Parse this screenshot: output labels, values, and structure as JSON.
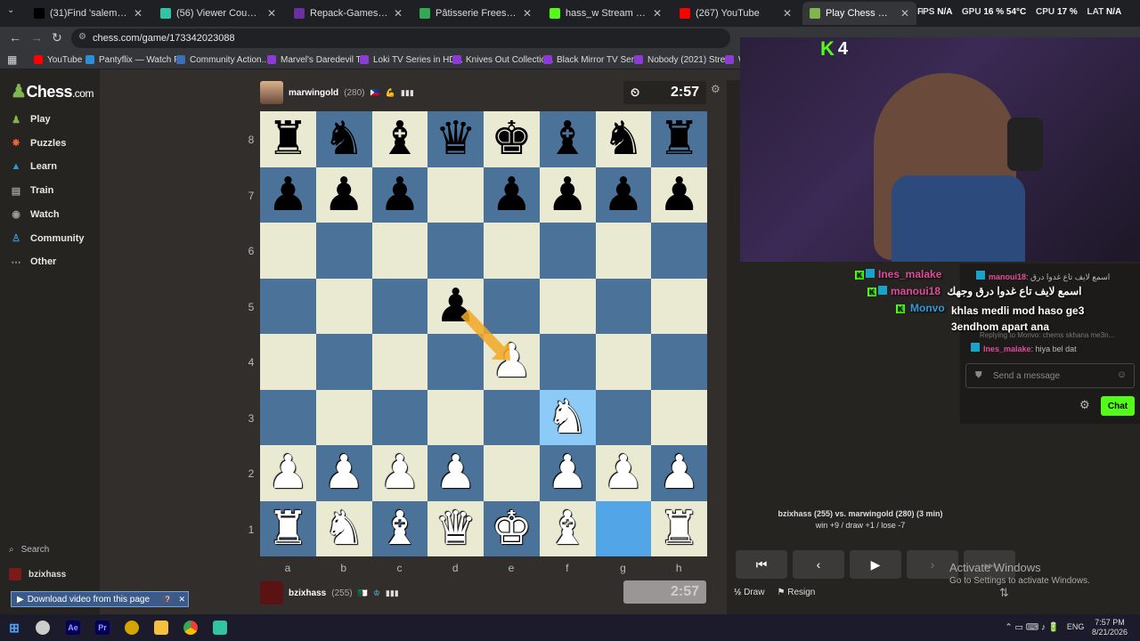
{
  "browser": {
    "tabs": [
      {
        "title": "(31)Find 'salember' on TikTok",
        "color": "#000000"
      },
      {
        "title": "(56) Viewer Count / Streamlabs",
        "color": "#31c3a2"
      },
      {
        "title": "Repack-Games - Free Download",
        "color": "#6b2fa0"
      },
      {
        "title": "Pâtisserie Freesia - Google Maps",
        "color": "#34a853"
      },
      {
        "title": "hass_w Stream - Watch Live",
        "color": "#53fc18"
      },
      {
        "title": "(267) YouTube",
        "color": "#ff0000"
      },
      {
        "title": "Play Chess Online for Free",
        "color": "#81b64c"
      }
    ],
    "url": "chess.com/game/173342023088",
    "bookmarks": [
      {
        "label": "YouTube",
        "color": "#ff0000"
      },
      {
        "label": "Pantyflix — Watch F...",
        "color": "#2d8fd8"
      },
      {
        "label": "Community Action...",
        "color": "#3b6fb6"
      },
      {
        "label": "Marvel's Daredevil T...",
        "color": "#8e3bd6"
      },
      {
        "label": "Loki TV Series in HD...",
        "color": "#8e3bd6"
      },
      {
        "label": "Knives Out Collectio...",
        "color": "#8e3bd6"
      },
      {
        "label": "Black Mirror TV Seri...",
        "color": "#8e3bd6"
      },
      {
        "label": "Nobody (2021) Stre...",
        "color": "#8e3bd6"
      },
      {
        "label": "W",
        "color": "#8e3bd6"
      }
    ]
  },
  "hud": {
    "fps_label": "FPS",
    "fps": "N/A",
    "gpu_label": "GPU",
    "gpu": "16 % 54°C",
    "cpu_label": "CPU",
    "cpu": "17 %",
    "lat_label": "LAT",
    "lat": "N/A"
  },
  "sidebar": {
    "logo_word": "Chess",
    "logo_suffix": ".com",
    "items": [
      {
        "label": "Play",
        "color": "#81b64c"
      },
      {
        "label": "Puzzles",
        "color": "#f0623a"
      },
      {
        "label": "Learn",
        "color": "#2d9cdb"
      },
      {
        "label": "Train",
        "color": "#9b9b9b"
      },
      {
        "label": "Watch",
        "color": "#9b9b9b"
      },
      {
        "label": "Community",
        "color": "#2d9cdb"
      },
      {
        "label": "Other",
        "color": "#9b9b9b"
      }
    ],
    "search": "Search",
    "user": "bzixhass"
  },
  "top_player": {
    "name": "marwingold",
    "rating": "(280)",
    "clock": "2:57"
  },
  "bottom_player": {
    "name": "bzixhass",
    "rating": "(255)",
    "clock": "2:57"
  },
  "board": {
    "ranks": [
      "8",
      "7",
      "6",
      "5",
      "4",
      "3",
      "2",
      "1"
    ],
    "files": [
      "a",
      "b",
      "c",
      "d",
      "e",
      "f",
      "g",
      "h"
    ],
    "position": [
      [
        "bR",
        "bN",
        "bB",
        "bQ",
        "bK",
        "bB",
        "bN",
        "bR"
      ],
      [
        "bP",
        "bP",
        "bP",
        "",
        "bP",
        "bP",
        "bP",
        "bP"
      ],
      [
        "",
        "",
        "",
        "",
        "",
        "",
        "",
        ""
      ],
      [
        "",
        "",
        "",
        "bP",
        "",
        "",
        "",
        ""
      ],
      [
        "",
        "",
        "",
        "",
        "wP",
        "",
        "",
        ""
      ],
      [
        "",
        "",
        "",
        "",
        "",
        "wN",
        "",
        ""
      ],
      [
        "wP",
        "wP",
        "wP",
        "wP",
        "",
        "wP",
        "wP",
        "wP"
      ],
      [
        "wR",
        "wN",
        "wB",
        "wQ",
        "wK",
        "wB",
        "",
        "wR"
      ]
    ],
    "last_move": [
      "g1",
      "f3"
    ],
    "arrow": [
      "d5",
      "e4"
    ]
  },
  "game": {
    "summary": "bzixhass (255) vs. marwingold (280) (3 min)",
    "record": "win +9 / draw +1 / lose -7",
    "draw_label": "Draw",
    "resign_label": "Resign"
  },
  "stream": {
    "kick_count": "4",
    "overlay_chat": [
      {
        "user": "Ines_malake",
        "text": ""
      },
      {
        "user": "manoui18",
        "text": "اسمع لايف تاع غدوا درق وجهك"
      },
      {
        "user": "Monvo",
        "text": "khlas medli mod haso ge3 3endhom apart ana"
      }
    ],
    "chat_lines": [
      {
        "user": "manoui18",
        "text": "اسمع لايف تاع غدوا درق"
      },
      {
        "user": "",
        "text": "Replying to Monvo: chems skhana me3n..."
      },
      {
        "user": "Ines_malake",
        "text": "hiya bel dat"
      }
    ],
    "chat_placeholder": "Send a message",
    "chat_button": "Chat"
  },
  "windows": {
    "activate_title": "Activate Windows",
    "activate_sub": "Go to Settings to activate Windows.",
    "download_label": "Download video from this page",
    "time": "7:57 PM",
    "date": "8/21/2026",
    "lang": "ENG"
  }
}
